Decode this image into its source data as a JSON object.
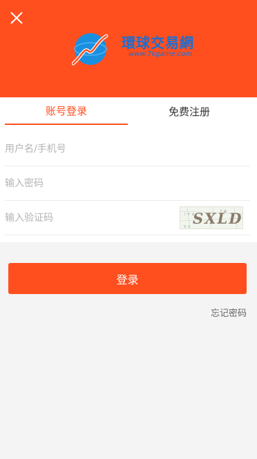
{
  "header": {
    "close_icon": "close-icon",
    "logo": {
      "name": "環球交易網",
      "url": "www.7kgame.com"
    },
    "background_color": "#ff4f1f"
  },
  "tabs": [
    {
      "label": "账号登录",
      "active": true
    },
    {
      "label": "免费注册",
      "active": false
    }
  ],
  "form": {
    "username_placeholder": "用户名/手机号",
    "password_placeholder": "输入密码",
    "captcha_placeholder": "输入验证码",
    "captcha_text": "SXLD"
  },
  "actions": {
    "login_label": "登录",
    "forgot_password_label": "忘记密码"
  },
  "colors": {
    "accent": "#ff4f1f",
    "logo_blue": "#1a6fd3"
  }
}
